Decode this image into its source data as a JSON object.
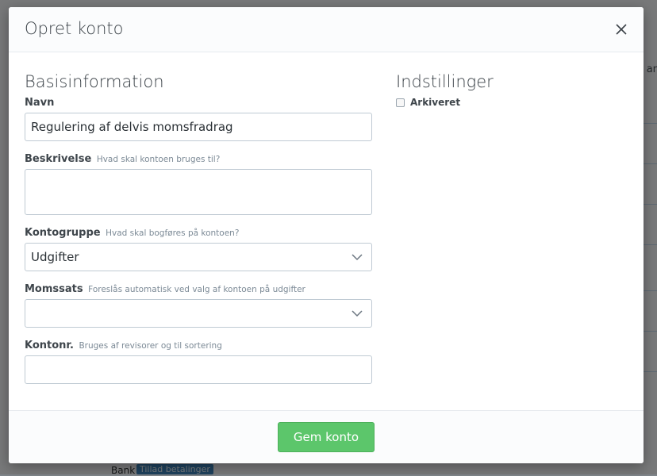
{
  "background": {
    "right_edge_text": "ar",
    "bank_label": "Bank",
    "bank_badge": "Tillad betalinger"
  },
  "modal": {
    "title": "Opret konto",
    "close_icon": "close-icon",
    "left": {
      "section_title": "Basisinformation",
      "name": {
        "label": "Navn",
        "value": "Regulering af delvis momsfradrag"
      },
      "description": {
        "label": "Beskrivelse",
        "hint": "Hvad skal kontoen bruges til?",
        "value": ""
      },
      "account_group": {
        "label": "Kontogruppe",
        "hint": "Hvad skal bogføres på kontoen?",
        "selected": "Udgifter"
      },
      "vat_rate": {
        "label": "Momssats",
        "hint": "Foreslås automatisk ved valg af kontoen på udgifter",
        "selected": ""
      },
      "account_number": {
        "label": "Kontonr.",
        "hint": "Bruges af revisorer og til sortering",
        "value": ""
      }
    },
    "right": {
      "section_title": "Indstillinger",
      "archived": {
        "label": "Arkiveret",
        "checked": false
      }
    },
    "footer": {
      "save_label": "Gem konto"
    }
  },
  "colors": {
    "primary_button": "#5cc66b",
    "badge": "#3c83ba"
  }
}
